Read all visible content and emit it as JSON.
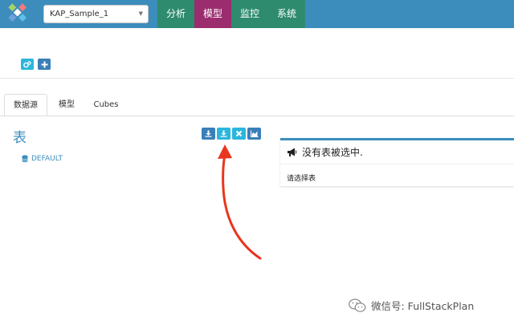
{
  "navbar": {
    "project_select": "KAP_Sample_1",
    "tabs": [
      "分析",
      "模型",
      "监控",
      "系统"
    ]
  },
  "subtabs": [
    "数据源",
    "模型",
    "Cubes"
  ],
  "section_title": "表",
  "tree": {
    "default_label": "DEFAULT"
  },
  "panel": {
    "heading": "没有表被选中.",
    "body": "请选择表"
  },
  "watermark": "微信号: FullStackPlan",
  "colors": {
    "navbar": "#3c8dbc",
    "tab_green": "#2e8b6e",
    "tab_active": "#9b2c6e",
    "button_blue": "#3a7fb8",
    "button_cyan": "#2bb6dd",
    "arrow": "#e8361f"
  },
  "icons": {
    "logo": "kap-logo-icon",
    "caret": "caret-down-icon",
    "action_buttons": [
      "cogs-icon",
      "plus-icon"
    ],
    "table_buttons": [
      "download-icon",
      "load-icon",
      "remove-icon",
      "chart-icon"
    ],
    "database": "database-icon",
    "megaphone": "bullhorn-icon",
    "wechat": "wechat-icon"
  }
}
